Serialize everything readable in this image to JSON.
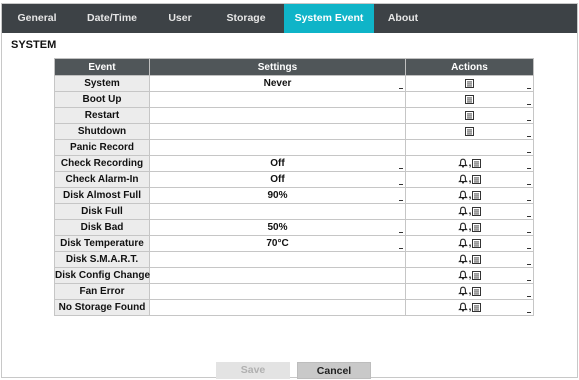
{
  "tabs": [
    {
      "label": "General"
    },
    {
      "label": "Date/Time"
    },
    {
      "label": "User"
    },
    {
      "label": "Storage"
    },
    {
      "label": "System Event"
    },
    {
      "label": "About"
    }
  ],
  "active_tab": "System Event",
  "colors": {
    "tab_bar": "#3d4246",
    "tab_active": "#0fb4c8",
    "header": "#505659"
  },
  "section_title": "SYSTEM",
  "table": {
    "headers": {
      "event": "Event",
      "settings": "Settings",
      "actions": "Actions"
    },
    "rows": [
      {
        "event": "System",
        "settings": "Never",
        "actions": [
          "note-icon"
        ]
      },
      {
        "event": "Boot Up",
        "settings": "",
        "actions": [
          "note-icon"
        ]
      },
      {
        "event": "Restart",
        "settings": "",
        "actions": [
          "note-icon"
        ]
      },
      {
        "event": "Shutdown",
        "settings": "",
        "actions": [
          "note-icon"
        ]
      },
      {
        "event": "Panic Record",
        "settings": "",
        "actions": []
      },
      {
        "event": "Check Recording",
        "settings": "Off",
        "actions": [
          "bell-icon",
          "note-icon"
        ]
      },
      {
        "event": "Check Alarm-In",
        "settings": "Off",
        "actions": [
          "bell-icon",
          "note-icon"
        ]
      },
      {
        "event": "Disk Almost Full",
        "settings": "90%",
        "actions": [
          "bell-icon",
          "note-icon"
        ]
      },
      {
        "event": "Disk Full",
        "settings": "",
        "actions": [
          "bell-icon",
          "note-icon"
        ]
      },
      {
        "event": "Disk Bad",
        "settings": "50%",
        "actions": [
          "bell-icon",
          "note-icon"
        ]
      },
      {
        "event": "Disk Temperature",
        "settings": "70°C",
        "actions": [
          "bell-icon",
          "note-icon"
        ]
      },
      {
        "event": "Disk S.M.A.R.T.",
        "settings": "",
        "actions": [
          "bell-icon",
          "note-icon"
        ]
      },
      {
        "event": "Disk Config Change",
        "settings": "",
        "actions": [
          "bell-icon",
          "note-icon"
        ]
      },
      {
        "event": "Fan Error",
        "settings": "",
        "actions": [
          "bell-icon",
          "note-icon"
        ]
      },
      {
        "event": "No Storage Found",
        "settings": "",
        "actions": [
          "bell-icon",
          "note-icon"
        ]
      }
    ]
  },
  "buttons": {
    "save": "Save",
    "cancel": "Cancel"
  }
}
